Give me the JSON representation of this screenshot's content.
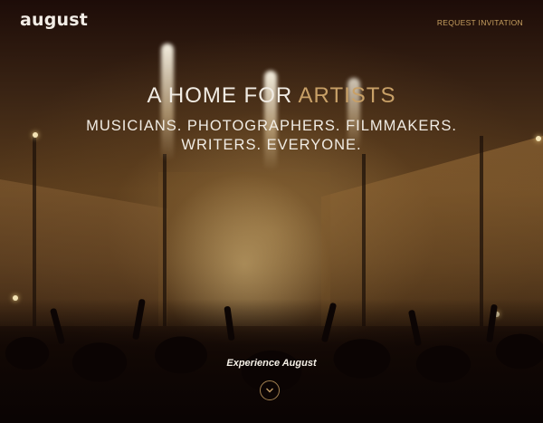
{
  "header": {
    "logo_text": "august",
    "request_link": "REQUEST INVITATION"
  },
  "hero": {
    "headline_prefix": "A HOME FOR",
    "headline_accent": "ARTISTS",
    "subline_1": "MUSICIANS. PHOTOGRAPHERS. FILMMAKERS.",
    "subline_2": "WRITERS. EVERYONE.",
    "cta_label": "Experience August",
    "scroll_icon": "chevron-down-icon"
  },
  "colors": {
    "accent": "#c8a067",
    "text": "#f1ece4",
    "background": "#140806"
  }
}
